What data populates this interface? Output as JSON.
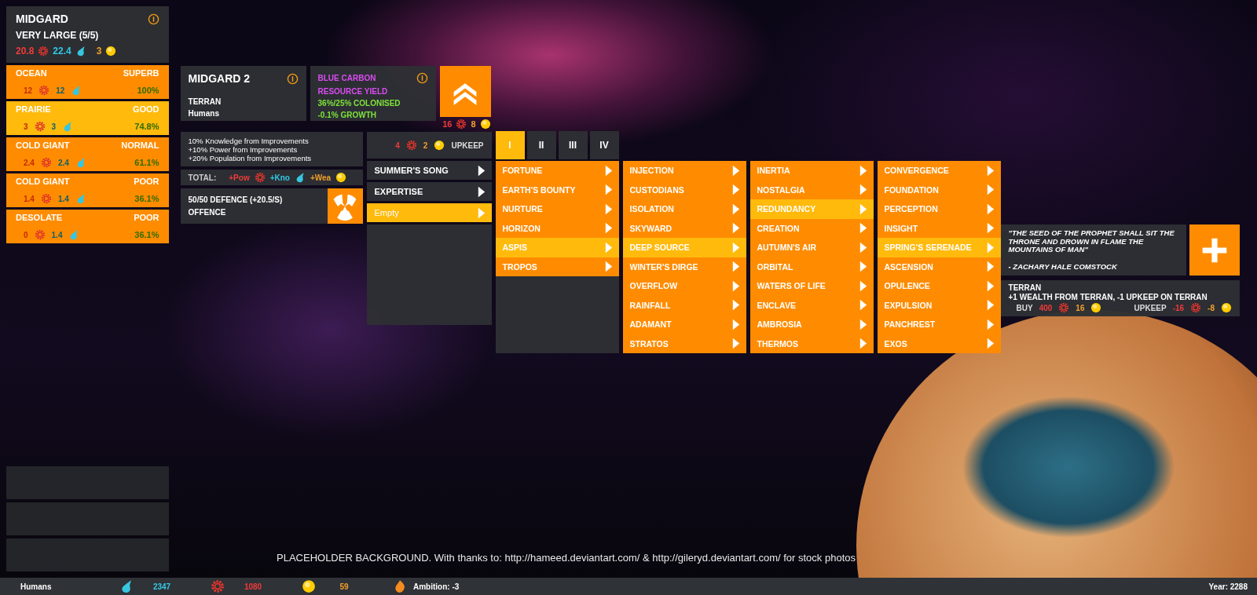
{
  "planet": {
    "name": "MIDGARD",
    "size": "VERY LARGE (5/5)",
    "power": "20.8",
    "knowledge": "22.4",
    "wealth": "3"
  },
  "terrains": [
    {
      "type": "OCEAN",
      "quality": "SUPERB",
      "power": "12",
      "knowledge": "12",
      "share": "100%",
      "selected": false
    },
    {
      "type": "PRAIRIE",
      "quality": "GOOD",
      "power": "3",
      "knowledge": "3",
      "share": "74.8%",
      "selected": true
    },
    {
      "type": "COLD GIANT",
      "quality": "NORMAL",
      "power": "2.4",
      "knowledge": "2.4",
      "share": "61.1%",
      "selected": false
    },
    {
      "type": "COLD GIANT",
      "quality": "POOR",
      "power": "1.4",
      "knowledge": "1.4",
      "share": "36.1%",
      "selected": false
    },
    {
      "type": "DESOLATE",
      "quality": "POOR",
      "power": "0",
      "knowledge": "1.4",
      "share": "36.1%",
      "selected": false
    }
  ],
  "colony": {
    "name": "MIDGARD 2",
    "type": "TERRAN",
    "species": "Humans"
  },
  "resource": {
    "name": "BLUE CARBON",
    "subtitle": "RESOURCE YIELD",
    "colonised": "36%/25% COLONISED",
    "growth": "-0.1% GROWTH"
  },
  "upgrade": {
    "power": "16",
    "wealth": "8"
  },
  "modifiers": [
    "10% Knowledge from Improvements",
    "+10% Power from Improvements",
    "+20% Population from Improvements"
  ],
  "total": {
    "label": "TOTAL:",
    "power": "+Pow",
    "knowledge": "+Kno",
    "wealth": "+Wea"
  },
  "defence": {
    "status": "50/50 DEFENCE (+20.5/S)",
    "mode": "OFFENCE"
  },
  "upkeep": {
    "power": "4",
    "wealth": "2",
    "label": "UPKEEP"
  },
  "slots": [
    {
      "label": "SUMMER'S SONG",
      "selected": false
    },
    {
      "label": "EXPERTISE",
      "selected": false
    },
    {
      "label": "Empty",
      "selected": true
    }
  ],
  "tiers": [
    {
      "label": "I",
      "selected": true
    },
    {
      "label": "II",
      "selected": false
    },
    {
      "label": "III",
      "selected": false
    },
    {
      "label": "IV",
      "selected": false
    }
  ],
  "menus": [
    {
      "items": [
        {
          "label": "FORTUNE",
          "selected": false
        },
        {
          "label": "EARTH'S BOUNTY",
          "selected": false
        },
        {
          "label": "NURTURE",
          "selected": false
        },
        {
          "label": "HORIZON",
          "selected": false
        },
        {
          "label": "ASPIS",
          "selected": true
        },
        {
          "label": "TROPOS",
          "selected": false
        }
      ]
    },
    {
      "items": [
        {
          "label": "INJECTION",
          "selected": false
        },
        {
          "label": "CUSTODIANS",
          "selected": false
        },
        {
          "label": "ISOLATION",
          "selected": false
        },
        {
          "label": "SKYWARD",
          "selected": false
        },
        {
          "label": "DEEP SOURCE",
          "selected": true
        },
        {
          "label": "WINTER'S DIRGE",
          "selected": false
        },
        {
          "label": "OVERFLOW",
          "selected": false
        },
        {
          "label": "RAINFALL",
          "selected": false
        },
        {
          "label": "ADAMANT",
          "selected": false
        },
        {
          "label": "STRATOS",
          "selected": false
        }
      ]
    },
    {
      "items": [
        {
          "label": "INERTIA",
          "selected": false
        },
        {
          "label": "NOSTALGIA",
          "selected": false
        },
        {
          "label": "REDUNDANCY",
          "selected": true
        },
        {
          "label": "CREATION",
          "selected": false
        },
        {
          "label": "AUTUMN'S AIR",
          "selected": false
        },
        {
          "label": "ORBITAL",
          "selected": false
        },
        {
          "label": "WATERS OF LIFE",
          "selected": false
        },
        {
          "label": "ENCLAVE",
          "selected": false
        },
        {
          "label": "AMBROSIA",
          "selected": false
        },
        {
          "label": "THERMOS",
          "selected": false
        }
      ]
    },
    {
      "items": [
        {
          "label": "CONVERGENCE",
          "selected": false
        },
        {
          "label": "FOUNDATION",
          "selected": false
        },
        {
          "label": "PERCEPTION",
          "selected": false
        },
        {
          "label": "INSIGHT",
          "selected": false
        },
        {
          "label": "SPRING'S SERENADE",
          "selected": true
        },
        {
          "label": "ASCENSION",
          "selected": false
        },
        {
          "label": "OPULENCE",
          "selected": false
        },
        {
          "label": "EXPULSION",
          "selected": false
        },
        {
          "label": "PANCHREST",
          "selected": false
        },
        {
          "label": "EXOS",
          "selected": false
        }
      ]
    }
  ],
  "quote": {
    "text": "\"THE SEED OF THE PROPHET SHALL SIT THE THRONE AND DROWN IN FLAME THE MOUNTAINS OF MAN\"",
    "author": "- ZACHARY HALE COMSTOCK"
  },
  "trait": {
    "name": "TERRAN",
    "effect": "+1 WEALTH FROM TERRAN, -1 UPKEEP ON TERRAN",
    "buy_label": "BUY",
    "buy_power": "400",
    "buy_wealth": "16",
    "upkeep_label": "UPKEEP",
    "upkeep_power": "-16",
    "upkeep_wealth": "-8"
  },
  "credits": "PLACEHOLDER BACKGROUND. With thanks to: http://hameed.deviantart.com/ & http://gileryd.deviantart.com/ for stock photos",
  "status": {
    "species": "Humans",
    "knowledge": "2347",
    "power": "1080",
    "wealth": "59",
    "ambition": "Ambition: -3",
    "year": "Year: 2288"
  }
}
